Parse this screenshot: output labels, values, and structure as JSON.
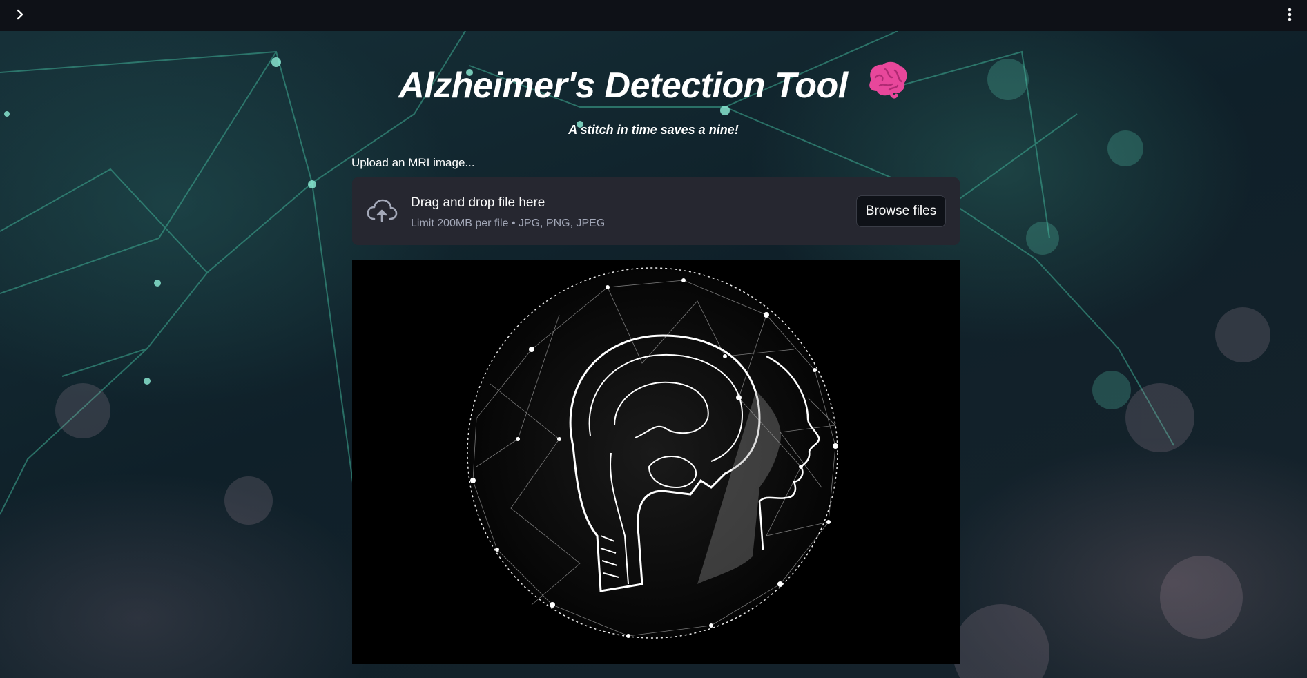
{
  "topbar": {
    "expand_icon": "chevron-right-icon",
    "menu_icon": "kebab-menu-icon"
  },
  "header": {
    "title": "Alzheimer's Detection Tool",
    "emoji": "brain-emoji",
    "subtitle": "A stitch in time saves a nine!"
  },
  "uploader": {
    "label": "Upload an MRI image...",
    "icon": "cloud-upload-icon",
    "drop_text": "Drag and drop file here",
    "limit_text": "Limit 200MB per file • JPG, PNG, JPEG",
    "browse_label": "Browse files"
  },
  "main_image": {
    "description_icon": "brain-head-illustration"
  },
  "colors": {
    "topbar": "#0e1117",
    "dropzone": "#262730",
    "accent_pink": "#e8479b"
  }
}
